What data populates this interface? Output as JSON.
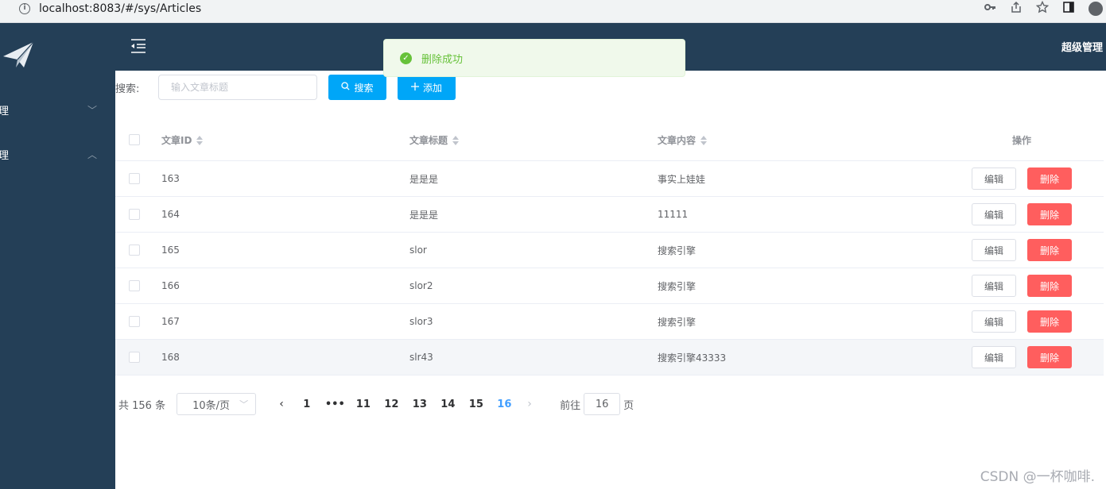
{
  "browser": {
    "url": "localhost:8083/#/sys/Articles",
    "info_glyph": "i"
  },
  "sidebar": {
    "items": [
      {
        "label": "理",
        "chevron": "﹀"
      },
      {
        "label": "理",
        "chevron": "︿"
      }
    ]
  },
  "header": {
    "user": "超级管理"
  },
  "toast": {
    "message": "删除成功"
  },
  "search": {
    "label": "搜索:",
    "placeholder": "输入文章标题",
    "search_button": "搜索",
    "add_button": "添加"
  },
  "table": {
    "columns": {
      "id": "文章ID",
      "title": "文章标题",
      "content": "文章内容",
      "op": "操作"
    },
    "edit_label": "编辑",
    "delete_label": "删除",
    "rows": [
      {
        "id": "163",
        "title": "是是是",
        "content": "事实上娃娃"
      },
      {
        "id": "164",
        "title": "是是是",
        "content": "11111"
      },
      {
        "id": "165",
        "title": "slor",
        "content": "搜索引擎"
      },
      {
        "id": "166",
        "title": "slor2",
        "content": "搜索引擎"
      },
      {
        "id": "167",
        "title": "slor3",
        "content": "搜索引擎"
      },
      {
        "id": "168",
        "title": "slr43",
        "content": "搜索引擎43333"
      }
    ]
  },
  "pagination": {
    "total": "共 156 条",
    "page_size": "10条/页",
    "prev": "‹",
    "next": "›",
    "pages": [
      "1",
      "•••",
      "11",
      "12",
      "13",
      "14",
      "15",
      "16"
    ],
    "current": "16",
    "goto_prefix": "前往",
    "goto_value": "16",
    "goto_suffix": "页"
  },
  "watermark": "CSDN @一杯咖啡."
}
